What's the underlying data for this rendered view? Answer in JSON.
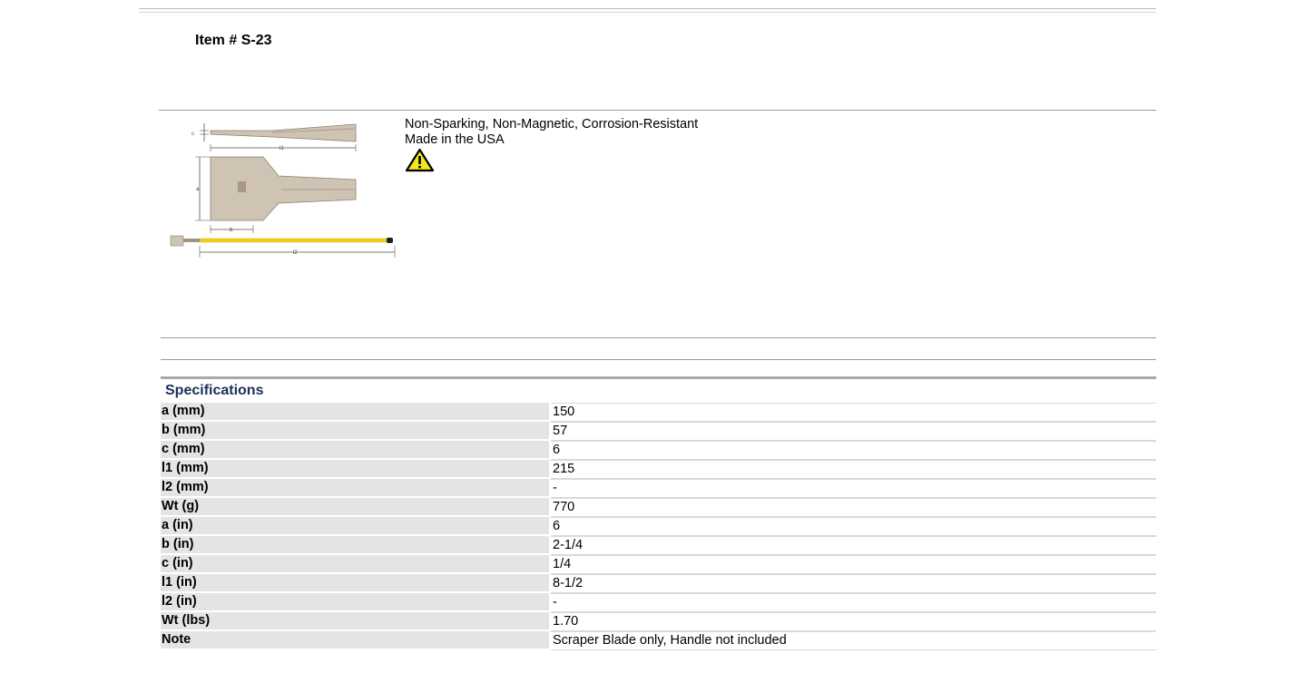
{
  "page": {
    "item_title": "Item # S-23",
    "description_lines": [
      "Non-Sparking, Non-Magnetic, Corrosion-Resistant",
      "Made in the USA"
    ],
    "warning_icon": "warning-triangle-icon",
    "diagram_labels": {
      "c": "c",
      "l1": "l1",
      "a": "a",
      "b": "b",
      "l2": "l2"
    }
  },
  "specifications": {
    "title": "Specifications",
    "rows": [
      {
        "label": "a (mm)",
        "value": "150"
      },
      {
        "label": "b (mm)",
        "value": "57"
      },
      {
        "label": "c (mm)",
        "value": "6"
      },
      {
        "label": "l1 (mm)",
        "value": "215"
      },
      {
        "label": "l2 (mm)",
        "value": "-"
      },
      {
        "label": "Wt (g)",
        "value": "770"
      },
      {
        "label": "a (in)",
        "value": "6"
      },
      {
        "label": "b (in)",
        "value": "2-1/4"
      },
      {
        "label": "c (in)",
        "value": "1/4"
      },
      {
        "label": "l1 (in)",
        "value": "8-1/2"
      },
      {
        "label": "l2 (in)",
        "value": "-"
      },
      {
        "label": "Wt (lbs)",
        "value": "1.70"
      },
      {
        "label": "Note",
        "value": "Scraper Blade only, Handle not included"
      }
    ]
  },
  "colors": {
    "spec_title": "#1c2e5c",
    "label_bg": "#e4e4e4",
    "handle_yellow": "#f2cf1a",
    "blade": "#cfc3b4"
  }
}
